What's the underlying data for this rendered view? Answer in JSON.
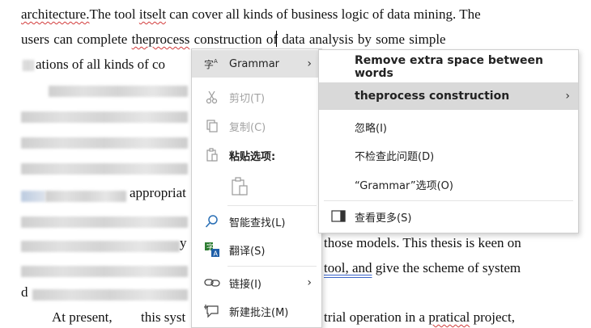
{
  "document": {
    "line1": {
      "w1": "architecture.",
      "w2": "The tool ",
      "w3": "itselt",
      "w4": " can cover all kinds of business logic of data mining. The"
    },
    "line2": {
      "w1": "users  can  complete  ",
      "w2": "theprocess",
      "w3": "  construction  of  data  analysis  by  some  simple"
    },
    "line3_tail": "ations of all kinds of co",
    "line7_word": "appropriat",
    "line9_word": "y",
    "line9_tail": "those models. This thesis is keen on",
    "line10_link": "tool, and",
    "line10_tail": " give the scheme of system",
    "line11_frag": "d",
    "line12_head": "At present,",
    "line12_mid": "this syst",
    "line12_tail1": "trial operation in a ",
    "line12_tail2": "pratical",
    "line12_tail3": " project,"
  },
  "context_menu": {
    "items": [
      {
        "label": "Grammar",
        "icon": "grammar-icon"
      },
      {
        "label": "剪切(T)",
        "icon": "scissors-icon"
      },
      {
        "label": "复制(C)",
        "icon": "copy-icon"
      },
      {
        "label": "粘贴选项:",
        "icon": "clipboard-icon"
      },
      {
        "label": "",
        "icon": "paste-keep-text-icon"
      },
      {
        "label": "智能查找(L)",
        "icon": "smart-lookup-icon"
      },
      {
        "label": "翻译(S)",
        "icon": "translate-icon"
      },
      {
        "label": "链接(I)",
        "icon": "link-icon"
      },
      {
        "label": "新建批注(M)",
        "icon": "new-comment-icon"
      }
    ]
  },
  "grammar_submenu": {
    "header": "Remove extra space between words",
    "suggestion": "theprocess construction",
    "ignore": "忽略(I)",
    "dont_check": "不检查此问题(D)",
    "options": "“Grammar”选项(O)",
    "see_more": "查看更多(S)"
  },
  "colors": {
    "highlight": "#e2e2e2",
    "spelling_underline": "#d23b3b",
    "grammar_underline": "#3a64c8",
    "disabled_text": "#a3a3a3"
  }
}
